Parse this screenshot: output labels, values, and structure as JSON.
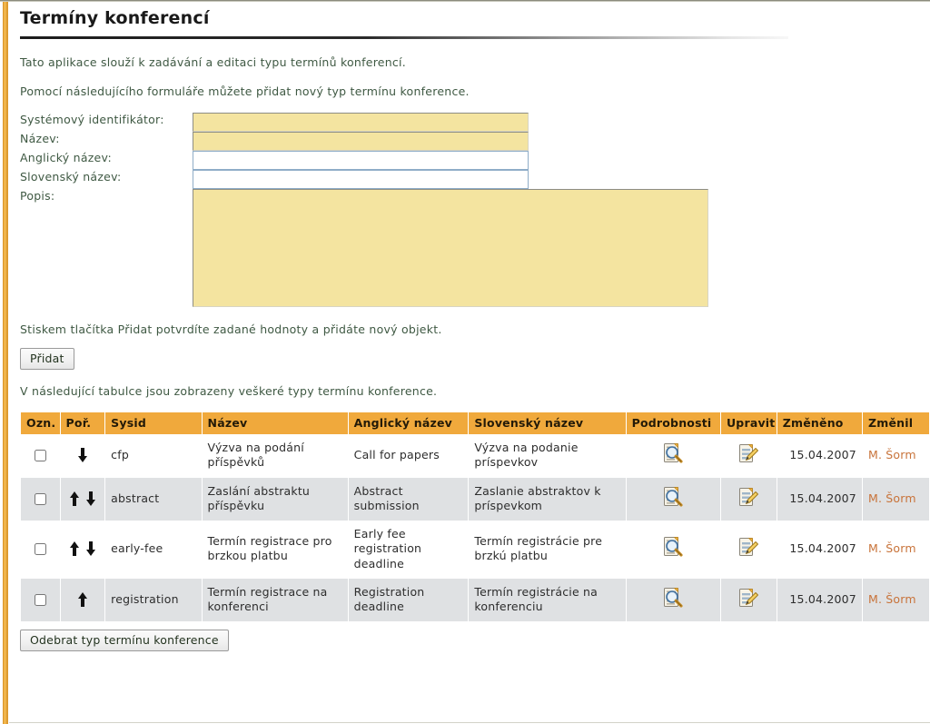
{
  "page": {
    "title": "Termíny konferencí",
    "intro_1": "Tato aplikace slouží k zadávání a editaci typu termínů konferencí.",
    "intro_2": "Pomocí následujícího formuláře můžete přidat nový typ termínu konference.",
    "submit_hint": "Stiskem tlačítka Přidat potvrdíte zadané hodnoty a přidáte nový objekt.",
    "table_hint": "V následující tabulce jsou zobrazeny veškeré typy termínu konference."
  },
  "form": {
    "fields": [
      {
        "label": "Systémový identifikátor:",
        "value": "",
        "placeholder": "",
        "required": true,
        "type": "text"
      },
      {
        "label": "Název:",
        "value": "",
        "placeholder": "",
        "required": true,
        "type": "text"
      },
      {
        "label": "Anglický název:",
        "value": "",
        "placeholder": "",
        "required": false,
        "type": "text"
      },
      {
        "label": "Slovenský název:",
        "value": "",
        "placeholder": "",
        "required": false,
        "type": "text"
      },
      {
        "label": "Popis:",
        "value": "",
        "placeholder": "",
        "required": true,
        "type": "textarea"
      }
    ],
    "add_button": "Přidat",
    "remove_button": "Odebrat typ termínu konference"
  },
  "table": {
    "columns": [
      "Ozn.",
      "Poř.",
      "Sysid",
      "Název",
      "Anglický název",
      "Slovenský název",
      "Podrobnosti",
      "Upravit",
      "Změněno",
      "Změnil"
    ],
    "rows": [
      {
        "checked": false,
        "order_up": false,
        "order_down": true,
        "sysid": "cfp",
        "name": "Výzva na podání příspěvků",
        "name_en": "Call for papers",
        "name_sk": "Výzva na podanie príspevkov",
        "detail_icon": "document-search-icon",
        "edit_icon": "document-pencil-icon",
        "changed": "15.04.2007",
        "changed_by": "M. Šorm"
      },
      {
        "checked": false,
        "order_up": true,
        "order_down": true,
        "sysid": "abstract",
        "name": "Zaslání abstraktu příspěvku",
        "name_en": "Abstract submission",
        "name_sk": "Zaslanie abstraktov k príspevkom",
        "detail_icon": "document-search-icon",
        "edit_icon": "document-pencil-icon",
        "changed": "15.04.2007",
        "changed_by": "M. Šorm"
      },
      {
        "checked": false,
        "order_up": true,
        "order_down": true,
        "sysid": "early-fee",
        "name": "Termín registrace pro brzkou platbu",
        "name_en": "Early fee registration deadline",
        "name_sk": "Termín registrácie pre brzkú platbu",
        "detail_icon": "document-search-icon",
        "edit_icon": "document-pencil-icon",
        "changed": "15.04.2007",
        "changed_by": "M. Šorm"
      },
      {
        "checked": false,
        "order_up": true,
        "order_down": false,
        "sysid": "registration",
        "name": "Termín registrace na konferenci",
        "name_en": "Registration deadline",
        "name_sk": "Termín registrácie na konferenciu",
        "detail_icon": "document-search-icon",
        "edit_icon": "document-pencil-icon",
        "changed": "15.04.2007",
        "changed_by": "M. Šorm"
      }
    ]
  },
  "colors": {
    "accent_orange": "#f0a93c",
    "left_bar": "#f0b44a",
    "required_field": "#f4e4a0",
    "optional_border": "#8fadc8",
    "row_stripe": "#dfe1e3",
    "link": "#c8733a",
    "body_text": "#3f5943"
  }
}
